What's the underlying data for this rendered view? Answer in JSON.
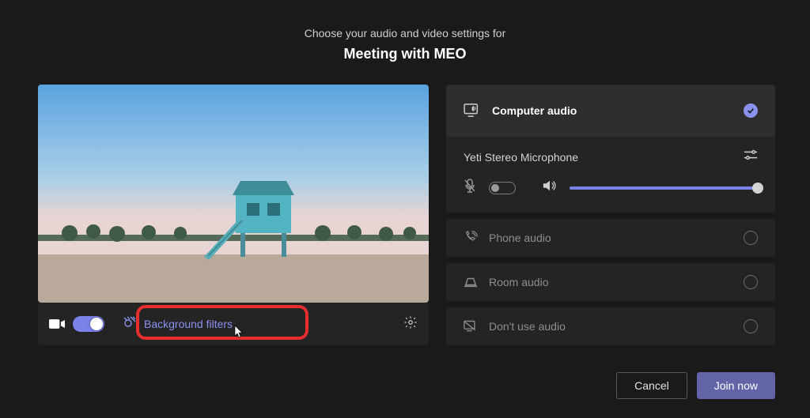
{
  "header": {
    "subtitle": "Choose your audio and video settings for",
    "title": "Meeting with MEO"
  },
  "video": {
    "bg_filters_label": "Background filters"
  },
  "audio": {
    "computer_audio_label": "Computer audio",
    "mic_label": "Yeti Stereo Microphone",
    "options": {
      "phone": "Phone audio",
      "room": "Room audio",
      "none": "Don't use audio"
    }
  },
  "footer": {
    "cancel": "Cancel",
    "join": "Join now"
  }
}
